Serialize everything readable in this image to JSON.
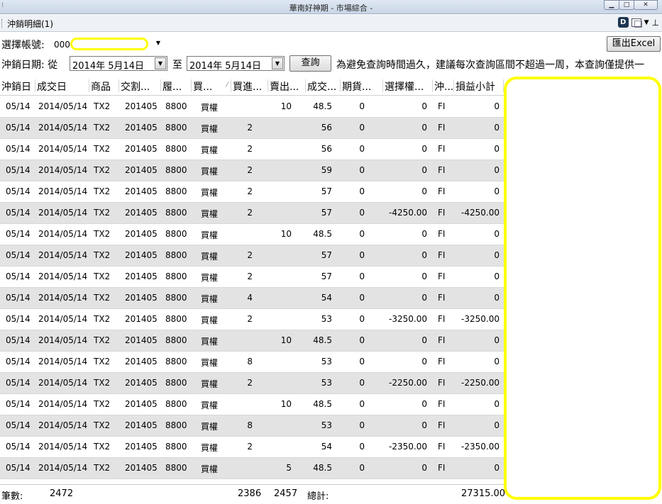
{
  "window": {
    "title": "華南好神期 - 市場綜合 -",
    "tab_label": "沖銷明細(1)",
    "minimize": "▁",
    "maximize": "□",
    "close": "✕"
  },
  "account": {
    "label": "選擇帳號:",
    "value": "000"
  },
  "toolbar": {
    "export_label": "匯出Excel",
    "date_label": "沖銷日期: 從",
    "date_from": "2014年  5月14日",
    "to_label": "至",
    "date_to": "2014年  5月14日",
    "query_label": "查詢",
    "notice": "為避免查詢時間過久，建議每次查詢區間不超過一周，本查詢僅提供一"
  },
  "columns": [
    "沖銷日",
    "成交日",
    "商品",
    "交割...",
    "履...",
    "買...",
    "買進...",
    "賣出...",
    "成交...",
    "期貨...",
    "選擇權...",
    "沖...",
    "損益小計"
  ],
  "rows": [
    [
      "05/14",
      "2014/05/14",
      "TX2",
      "201405",
      "8800",
      "買權",
      "",
      "10",
      "48.5",
      "0",
      "0",
      "FI",
      "0"
    ],
    [
      "05/14",
      "2014/05/14",
      "TX2",
      "201405",
      "8800",
      "買權",
      "2",
      "",
      "56",
      "0",
      "0",
      "FI",
      "0"
    ],
    [
      "05/14",
      "2014/05/14",
      "TX2",
      "201405",
      "8800",
      "買權",
      "2",
      "",
      "56",
      "0",
      "0",
      "FI",
      "0"
    ],
    [
      "05/14",
      "2014/05/14",
      "TX2",
      "201405",
      "8800",
      "買權",
      "2",
      "",
      "59",
      "0",
      "0",
      "FI",
      "0"
    ],
    [
      "05/14",
      "2014/05/14",
      "TX2",
      "201405",
      "8800",
      "買權",
      "2",
      "",
      "57",
      "0",
      "0",
      "FI",
      "0"
    ],
    [
      "05/14",
      "2014/05/14",
      "TX2",
      "201405",
      "8800",
      "買權",
      "2",
      "",
      "57",
      "0",
      "-4250.00",
      "FI",
      "-4250.00"
    ],
    [
      "05/14",
      "2014/05/14",
      "TX2",
      "201405",
      "8800",
      "買權",
      "",
      "10",
      "48.5",
      "0",
      "0",
      "FI",
      "0"
    ],
    [
      "05/14",
      "2014/05/14",
      "TX2",
      "201405",
      "8800",
      "買權",
      "2",
      "",
      "57",
      "0",
      "0",
      "FI",
      "0"
    ],
    [
      "05/14",
      "2014/05/14",
      "TX2",
      "201405",
      "8800",
      "買權",
      "2",
      "",
      "57",
      "0",
      "0",
      "FI",
      "0"
    ],
    [
      "05/14",
      "2014/05/14",
      "TX2",
      "201405",
      "8800",
      "買權",
      "4",
      "",
      "54",
      "0",
      "0",
      "FI",
      "0"
    ],
    [
      "05/14",
      "2014/05/14",
      "TX2",
      "201405",
      "8800",
      "買權",
      "2",
      "",
      "53",
      "0",
      "-3250.00",
      "FI",
      "-3250.00"
    ],
    [
      "05/14",
      "2014/05/14",
      "TX2",
      "201405",
      "8800",
      "買權",
      "",
      "10",
      "48.5",
      "0",
      "0",
      "FI",
      "0"
    ],
    [
      "05/14",
      "2014/05/14",
      "TX2",
      "201405",
      "8800",
      "買權",
      "8",
      "",
      "53",
      "0",
      "0",
      "FI",
      "0"
    ],
    [
      "05/14",
      "2014/05/14",
      "TX2",
      "201405",
      "8800",
      "買權",
      "2",
      "",
      "53",
      "0",
      "-2250.00",
      "FI",
      "-2250.00"
    ],
    [
      "05/14",
      "2014/05/14",
      "TX2",
      "201405",
      "8800",
      "買權",
      "",
      "10",
      "48.5",
      "0",
      "0",
      "FI",
      "0"
    ],
    [
      "05/14",
      "2014/05/14",
      "TX2",
      "201405",
      "8800",
      "買權",
      "8",
      "",
      "53",
      "0",
      "0",
      "FI",
      "0"
    ],
    [
      "05/14",
      "2014/05/14",
      "TX2",
      "201405",
      "8800",
      "買權",
      "2",
      "",
      "54",
      "0",
      "-2350.00",
      "FI",
      "-2350.00"
    ],
    [
      "05/14",
      "2014/05/14",
      "TX2",
      "201405",
      "8800",
      "買權",
      "",
      "5",
      "48.5",
      "0",
      "0",
      "FI",
      "0"
    ]
  ],
  "footer": {
    "count_label": "筆數:",
    "count": "2472",
    "buy_total": "2386",
    "sell_total": "2457",
    "total_label": "總計:",
    "pnl_total": "27315.00"
  },
  "colors": {
    "highlight": "#ffff00",
    "alt_row": "#e3e3e3"
  }
}
